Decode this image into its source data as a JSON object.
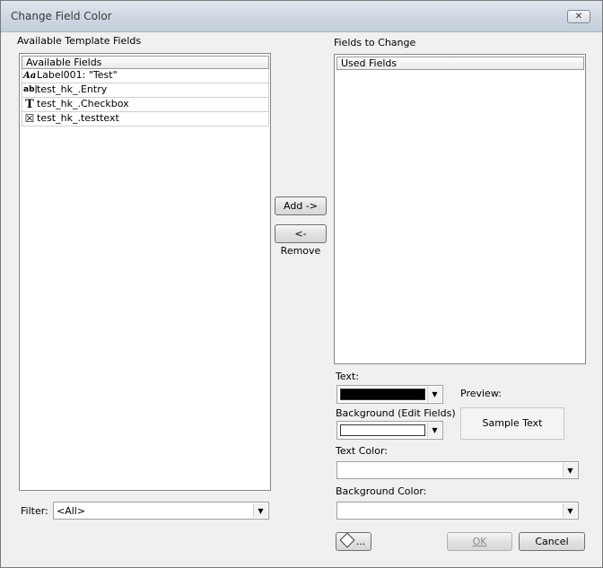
{
  "window": {
    "title": "Change Field Color",
    "close_glyph": "✕"
  },
  "left_panel": {
    "section_label": "Available Template Fields",
    "column_header": "Available Fields",
    "items": [
      {
        "icon": "text-label-icon",
        "glyph": "Aa",
        "label": "Label001: \"Test\""
      },
      {
        "icon": "entry-field-icon",
        "glyph": "ab|",
        "label": "test_hk_.Entry"
      },
      {
        "icon": "text-field-icon",
        "glyph": "T",
        "label": "test_hk_.Checkbox"
      },
      {
        "icon": "checkbox-icon",
        "glyph": "☒",
        "label": "test_hk_.testtext"
      }
    ],
    "filter_label": "Filter:",
    "filter_value": "<All>"
  },
  "buttons": {
    "add": "Add ->",
    "remove": "<- Remove",
    "color_picker": "...",
    "ok": "OK",
    "cancel": "Cancel"
  },
  "right_panel": {
    "section_label": "Fields to Change",
    "column_header": "Used Fields",
    "text_label": "Text:",
    "text_swatch_color": "#000000",
    "background_edit_label": "Background (Edit Fields)",
    "background_swatch_color": "#ffffff",
    "preview_label": "Preview:",
    "preview_sample": "Sample Text",
    "text_color_label": "Text Color:",
    "text_color_value": "",
    "background_color_label": "Background Color:",
    "background_color_value": ""
  },
  "arrow_glyph": "▼"
}
